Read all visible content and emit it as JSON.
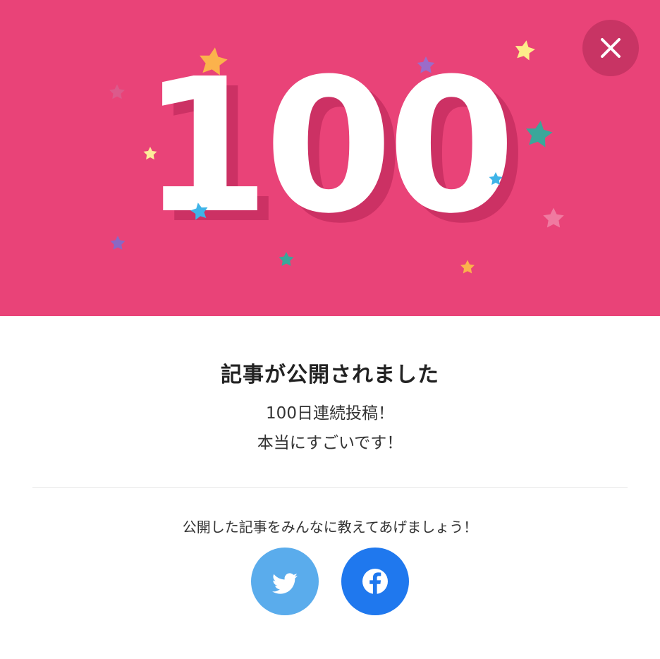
{
  "hero": {
    "count": "100",
    "background_color": "#e94378",
    "shadow_color": "#cc3164"
  },
  "close_button": {
    "icon": "close-icon"
  },
  "content": {
    "title": "記事が公開されました",
    "message_line1": "100日連続投稿！",
    "message_line2": "本当にすごいです！",
    "share_prompt": "公開した記事をみんなに教えてあげましょう！"
  },
  "share": {
    "twitter": {
      "icon": "twitter-bird-icon",
      "color": "#5aacec"
    },
    "facebook": {
      "icon": "facebook-f-icon",
      "color": "#1f78ee"
    }
  }
}
